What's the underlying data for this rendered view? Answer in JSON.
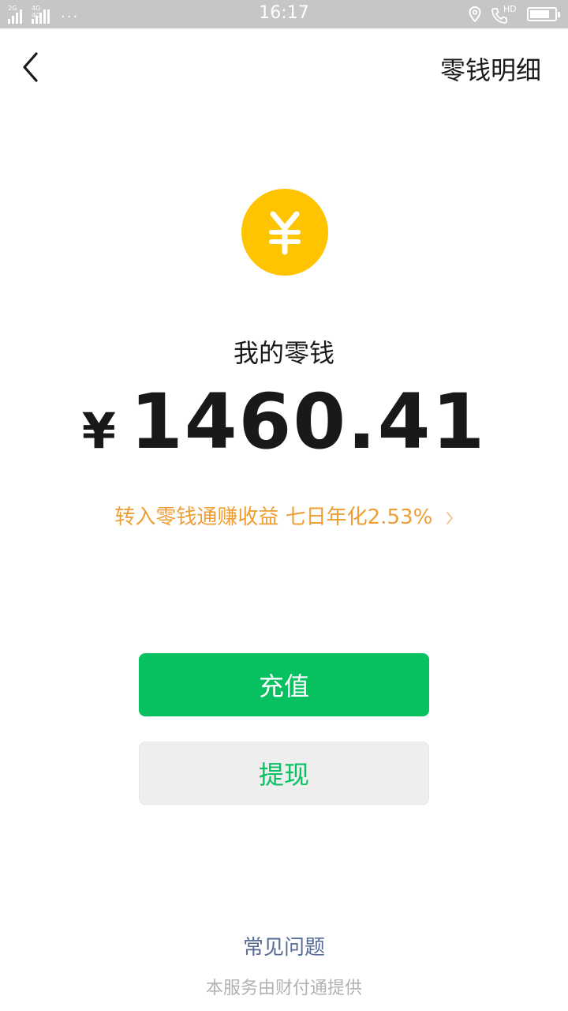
{
  "status_bar": {
    "time": "16:17",
    "signal1_label": "2G",
    "signal2_label": "4G 4G",
    "dots": "···",
    "hd_label": "HD",
    "battery_level": 0.8
  },
  "nav": {
    "right_label": "零钱明细"
  },
  "wallet": {
    "title": "我的零钱",
    "currency_symbol": "¥",
    "balance": "1460.41"
  },
  "promo": {
    "text": "转入零钱通赚收益 七日年化2.53%"
  },
  "actions": {
    "recharge_label": "充值",
    "withdraw_label": "提现"
  },
  "footer": {
    "faq_label": "常见问题",
    "provider_note": "本服务由财付通提供"
  },
  "colors": {
    "brand_green": "#07c160",
    "coin_yellow": "#fec400",
    "promo_orange": "#ee9e34",
    "link_blue": "#576b95"
  }
}
